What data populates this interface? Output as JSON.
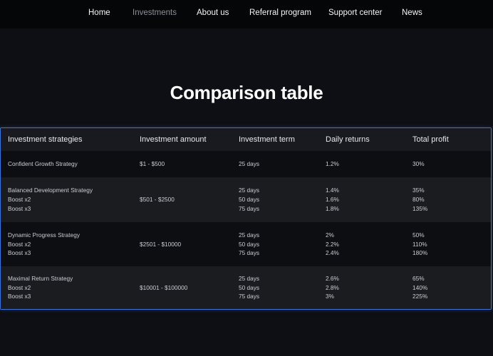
{
  "nav": {
    "items": [
      "Home",
      "Investments",
      "About us",
      "Referral program",
      "Support center",
      "News"
    ]
  },
  "page": {
    "title": "Comparison table"
  },
  "table": {
    "headers": [
      "Investment strategies",
      "Investment amount",
      "Investment term",
      "Daily returns",
      "Total profit"
    ],
    "rows": [
      {
        "strategy": [
          "Confident Growth Strategy"
        ],
        "amount": "$1 - $500",
        "term": [
          "25 days"
        ],
        "daily": [
          "1.2%"
        ],
        "profit": [
          "30%"
        ]
      },
      {
        "strategy": [
          "Balanced Development Strategy",
          "Boost x2",
          "Boost x3"
        ],
        "amount": "$501 - $2500",
        "term": [
          "25 days",
          "50 days",
          "75 days"
        ],
        "daily": [
          "1.4%",
          "1.6%",
          "1.8%"
        ],
        "profit": [
          "35%",
          "80%",
          "135%"
        ]
      },
      {
        "strategy": [
          "Dynamic Progress Strategy",
          "Boost x2",
          "Boost x3"
        ],
        "amount": "$2501 - $10000",
        "term": [
          "25 days",
          "50 days",
          "75 days"
        ],
        "daily": [
          "2%",
          "2.2%",
          "2.4%"
        ],
        "profit": [
          "50%",
          "110%",
          "180%"
        ]
      },
      {
        "strategy": [
          "Maximal Return Strategy",
          "Boost x2",
          "Boost x3"
        ],
        "amount": "$10001 - $100000",
        "term": [
          "25 days",
          "50 days",
          "75 days"
        ],
        "daily": [
          "2.6%",
          "2.8%",
          "3%"
        ],
        "profit": [
          "65%",
          "140%",
          "225%"
        ]
      }
    ]
  },
  "colors": {
    "accent_border": "#3f72d9",
    "active_nav": "#8a8f98"
  }
}
